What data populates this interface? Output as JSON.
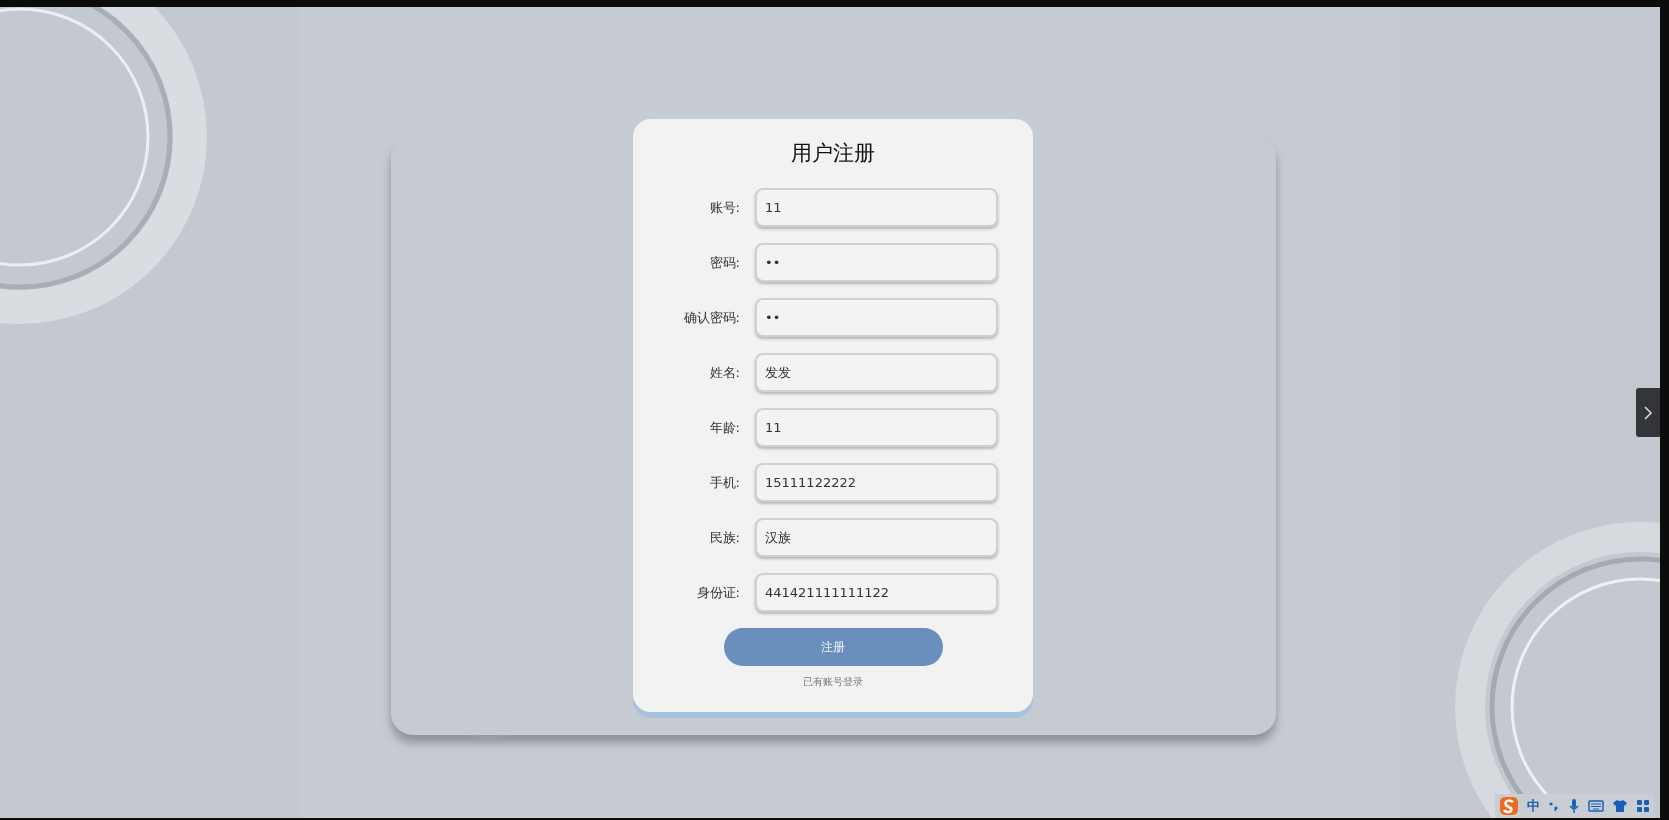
{
  "form": {
    "title": "用户注册",
    "fields": [
      {
        "label": "账号:",
        "value": "11"
      },
      {
        "label": "密码:",
        "value": "••"
      },
      {
        "label": "确认密码:",
        "value": "••"
      },
      {
        "label": "姓名:",
        "value": "发发"
      },
      {
        "label": "年龄:",
        "value": "11"
      },
      {
        "label": "手机:",
        "value": "15111122222"
      },
      {
        "label": "民族:",
        "value": "汉族"
      },
      {
        "label": "身份证:",
        "value": "441421111111122"
      }
    ],
    "submit": "注册",
    "login_link": "已有账号登录"
  },
  "ime_toolbar": {
    "mode": "中"
  }
}
